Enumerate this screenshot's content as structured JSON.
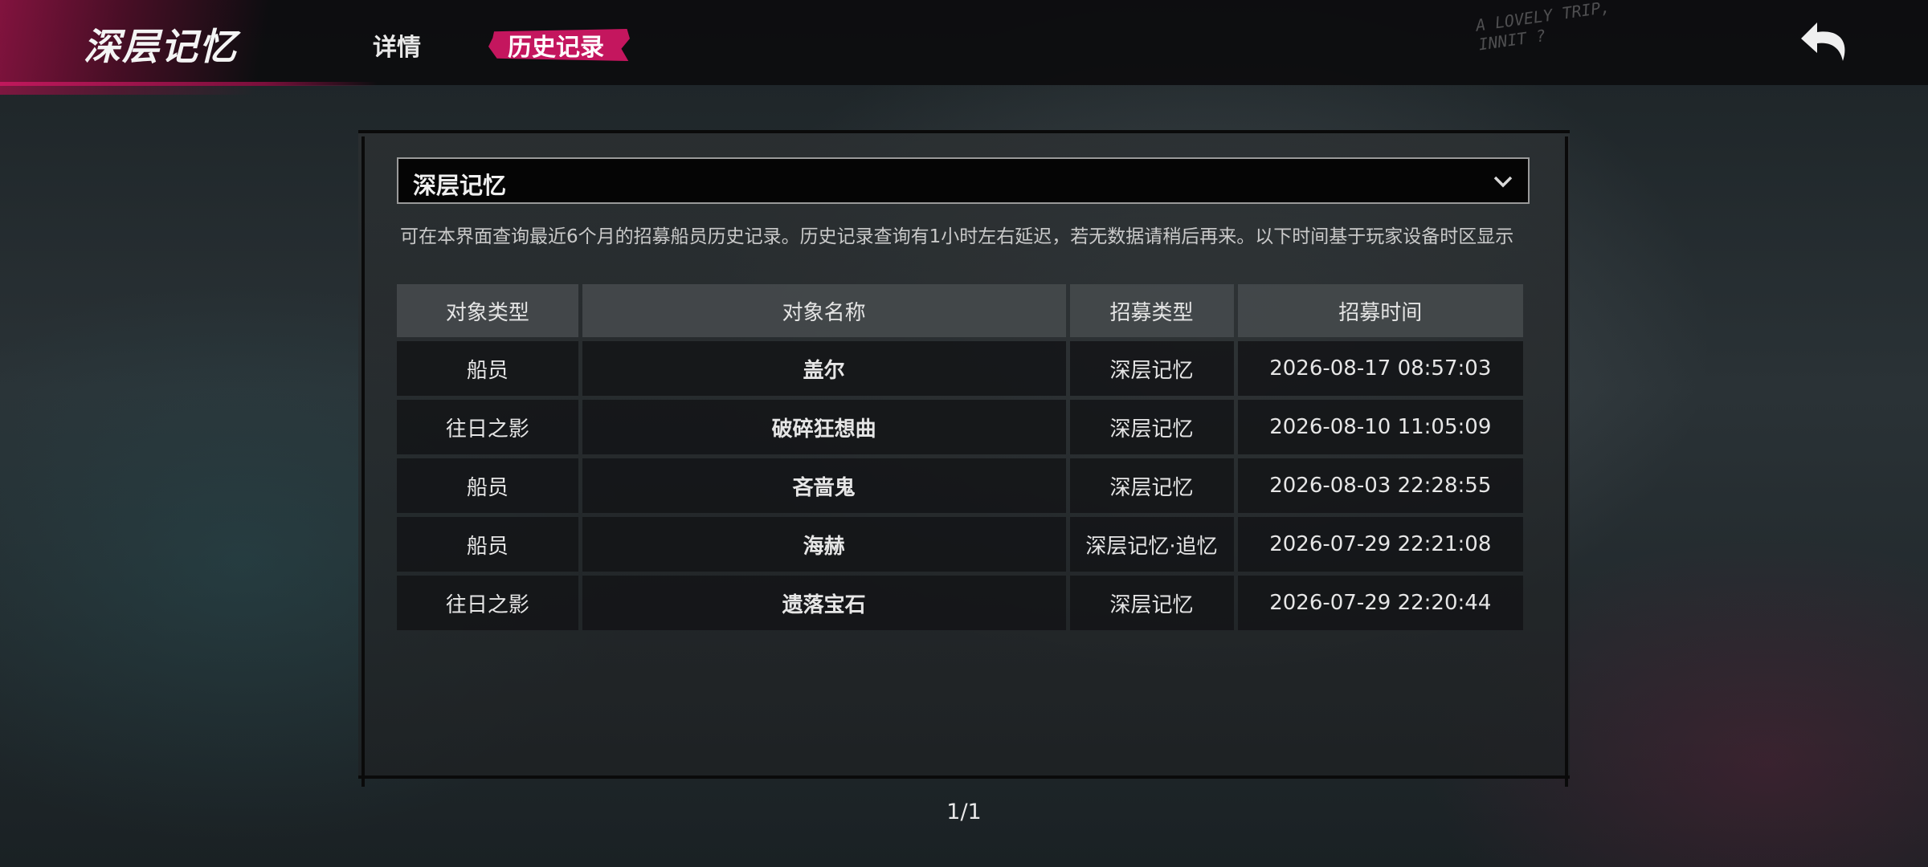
{
  "header": {
    "title": "深层记忆",
    "tabs": [
      {
        "label": "详情",
        "active": false
      },
      {
        "label": "历史记录",
        "active": true
      }
    ],
    "scribble": [
      "A LOVELY TRIP,",
      "INNIT ?"
    ],
    "back_icon": "back-arrow-icon"
  },
  "filter": {
    "selected": "深层记忆",
    "icon": "chevron-down-icon"
  },
  "notice": "可在本界面查询最近6个月的招募船员历史记录。历史记录查询有1小时左右延迟，若无数据请稍后再来。以下时间基于玩家设备时区显示",
  "table": {
    "columns": [
      "对象类型",
      "对象名称",
      "招募类型",
      "招募时间"
    ],
    "rows": [
      {
        "type": "船员",
        "name": "盖尔",
        "rarity": "gold",
        "recruit_type": "深层记忆",
        "time": "2026-08-17 08:57:03"
      },
      {
        "type": "往日之影",
        "name": "破碎狂想曲",
        "rarity": "gold",
        "recruit_type": "深层记忆",
        "time": "2026-08-10 11:05:09"
      },
      {
        "type": "船员",
        "name": "吝啬鬼",
        "rarity": "purple",
        "recruit_type": "深层记忆",
        "time": "2026-08-03 22:28:55"
      },
      {
        "type": "船员",
        "name": "海赫",
        "rarity": "purple",
        "recruit_type": "深层记忆·追忆",
        "time": "2026-07-29 22:21:08"
      },
      {
        "type": "往日之影",
        "name": "遗落宝石",
        "rarity": "gold",
        "recruit_type": "深层记忆",
        "time": "2026-07-29 22:20:44"
      }
    ]
  },
  "colors": {
    "accent": "#c4165e",
    "gold": "#f1a83a",
    "purple": "#c24cf0"
  },
  "pagination": "1/1"
}
